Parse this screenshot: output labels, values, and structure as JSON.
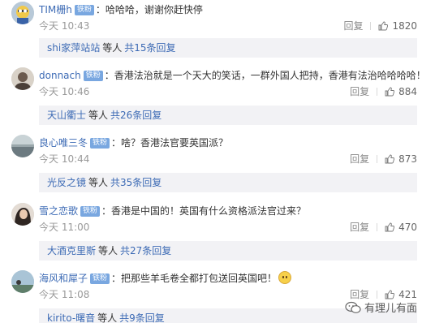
{
  "comments": [
    {
      "username": "TIM栅h",
      "badge": "铁粉",
      "colon": "：",
      "text": "哈哈哈，谢谢你赶快停",
      "time": "今天 10:43",
      "reply_label": "回复",
      "likes": "1820",
      "sub_user": "shi家萍站站",
      "sub_etc": "等人",
      "sub_link": "共15条回复"
    },
    {
      "username": "donnach",
      "badge": "铁粉",
      "colon": "：",
      "text": "香港法治就是一个天大的笑话，一群外国人把持，香港有法治哈哈哈哈！",
      "time": "今天 10:46",
      "reply_label": "回复",
      "likes": "884",
      "sub_user": "天山衢士",
      "sub_etc": "等人",
      "sub_link": "共26条回复"
    },
    {
      "username": "良心唯三冬",
      "badge": "铁粉",
      "colon": "：",
      "text": "啥？香港法官要英国派？",
      "time": "今天 10:44",
      "reply_label": "回复",
      "likes": "873",
      "sub_user": "光反之镜",
      "sub_etc": "等人",
      "sub_link": "共35条回复"
    },
    {
      "username": "雪之恋歌",
      "badge": "铁粉",
      "colon": "：",
      "text": "香港是中国的！英国有什么资格派法官过来？",
      "time": "今天 11:00",
      "reply_label": "回复",
      "likes": "470",
      "sub_user": "大酒克里斯",
      "sub_etc": "等人",
      "sub_link": "共27条回复"
    },
    {
      "username": "海风和犀子",
      "badge": "铁粉",
      "colon": "：",
      "text": "把那些羊毛卷全都打包送回英国吧！",
      "time": "今天 11:08",
      "reply_label": "回复",
      "likes": "421",
      "sub_user": "kirito-曙音",
      "sub_etc": "等人",
      "sub_link": "共9条回复"
    }
  ],
  "watermark": "有理儿有面",
  "colors": {
    "link": "#3d6bb5",
    "badge": "#79a7e0",
    "sub_bg": "#f2f2f5",
    "meta": "#999999"
  }
}
